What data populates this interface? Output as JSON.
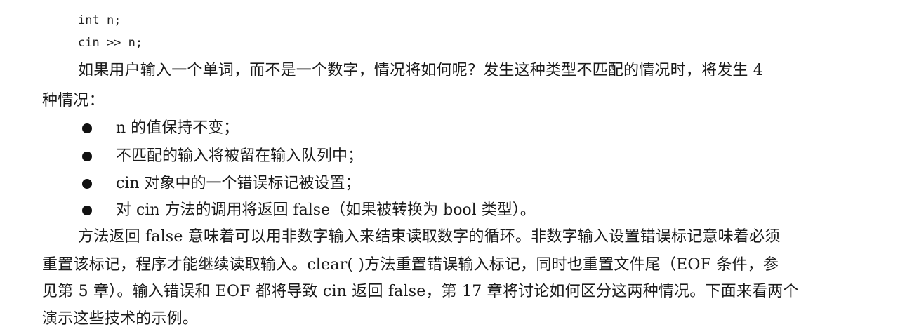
{
  "code": {
    "lines": [
      "int n;",
      "cin >> n;"
    ]
  },
  "intro": {
    "line1": "如果用户输入一个单词，而不是一个数字，情况将如何呢？发生这种类型不匹配的情况时，将发生 4",
    "line2": "种情况："
  },
  "bullets": [
    "n 的值保持不变；",
    "不匹配的输入将被留在输入队列中；",
    "cin 对象中的一个错误标记被设置；",
    "对 cin 方法的调用将返回 false（如果被转换为 bool 类型）。"
  ],
  "paragraph": {
    "line1": "方法返回 false 意味着可以用非数字输入来结束读取数字的循环。非数字输入设置错误标记意味着必须",
    "line2": "重置该标记，程序才能继续读取输入。clear( )方法重置错误输入标记，同时也重置文件尾（EOF 条件，参",
    "line3": "见第 5 章）。输入错误和 EOF 都将导致 cin 返回 false，第 17 章将讨论如何区分这两种情况。下面来看两个",
    "line4": "演示这些技术的示例。"
  }
}
